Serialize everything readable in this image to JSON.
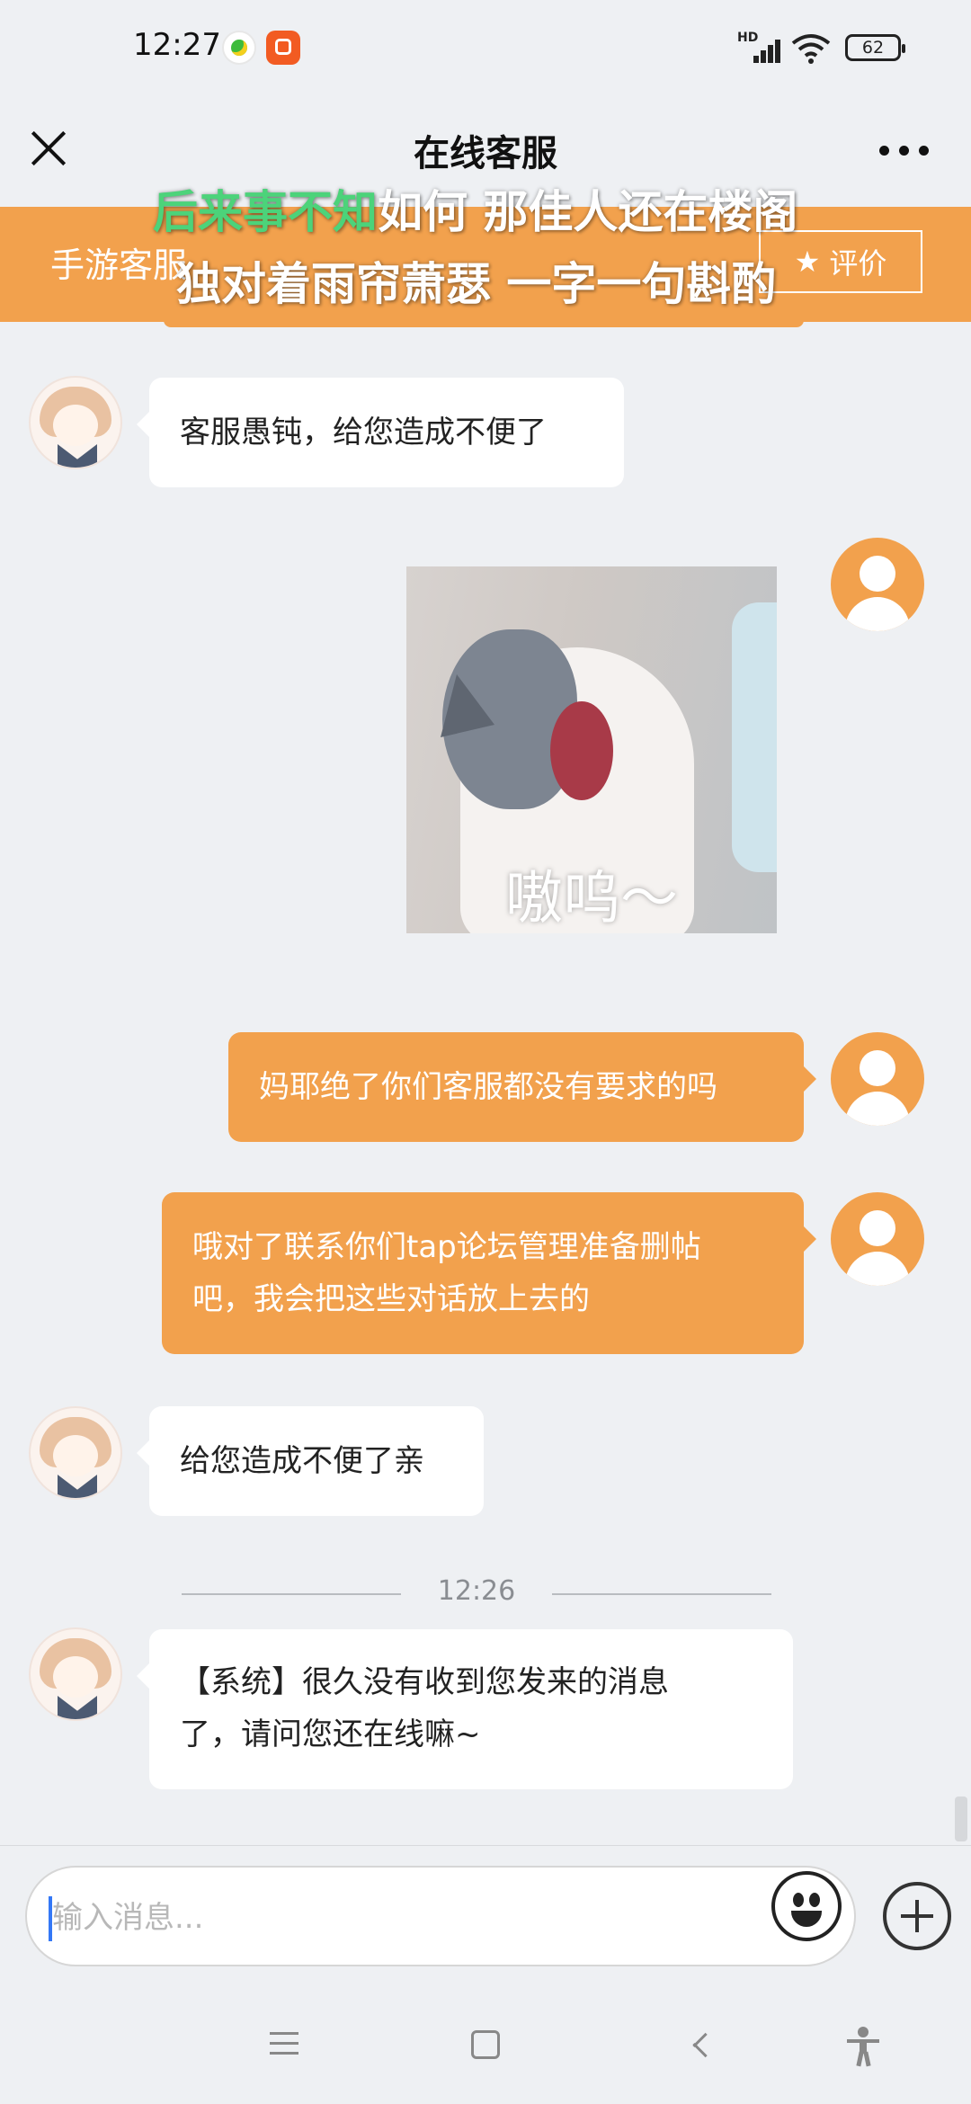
{
  "status_bar": {
    "time": "12:27",
    "network_badge": "HD",
    "battery": "62",
    "icons": [
      "app-icon-music",
      "app-icon-video",
      "signal-icon",
      "wifi-icon",
      "battery-icon"
    ]
  },
  "header": {
    "title": "在线客服",
    "close_icon": "close-icon",
    "more_icon": "more-icon"
  },
  "banner": {
    "label": "手游客服",
    "rate_label": "评价",
    "rate_icon": "star-icon",
    "color": "#f2a14d"
  },
  "lyrics": {
    "line1_highlight": "后来事不知",
    "line1_rest": "如何 那佳人还在楼阁",
    "line2": "独对着雨帘萧瑟 一字一句斟酌"
  },
  "messages": [
    {
      "from": "agent",
      "text": "客服愚钝，给您造成不便了"
    },
    {
      "from": "user",
      "type": "sticker",
      "caption": "嗷呜～"
    },
    {
      "from": "user",
      "text": "妈耶绝了你们客服都没有要求的吗"
    },
    {
      "from": "user",
      "text_line1": "哦对了联系你们tap论坛管理准备删帖",
      "text_line2": "吧，我会把这些对话放上去的"
    },
    {
      "from": "agent",
      "text": "给您造成不便了亲"
    },
    {
      "type": "time_divider",
      "time": "12:26"
    },
    {
      "from": "agent",
      "text_line1": "【系统】很久没有收到您发来的消息",
      "text_line2": "了，请问您还在线嘛~"
    }
  ],
  "input": {
    "placeholder": "输入消息...",
    "value": "",
    "emoji_icon": "emoji-icon",
    "plus_icon": "plus-icon"
  },
  "nav": {
    "icons": [
      "menu-icon",
      "home-icon",
      "back-icon",
      "accessibility-icon"
    ]
  },
  "colors": {
    "accent": "#f2a14d",
    "background": "#eef0f3",
    "agent_bubble": "#ffffff"
  }
}
